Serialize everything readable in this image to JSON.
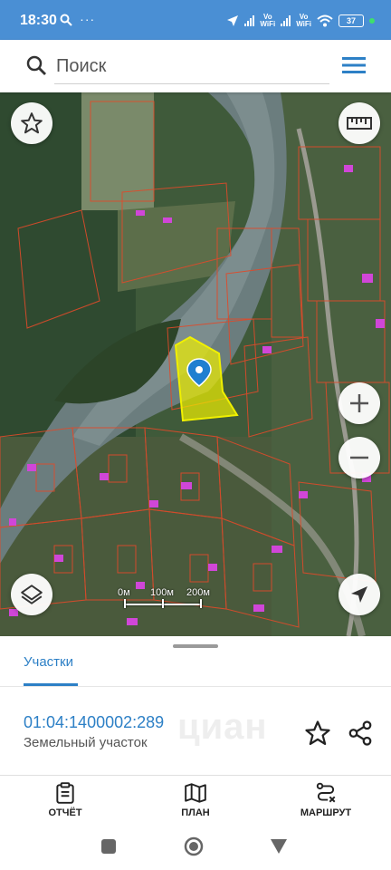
{
  "status_bar": {
    "time": "18:30",
    "left_icons": [
      "search-icon",
      "more-dots-icon"
    ],
    "vowifi_label": "Vo\nWiFi",
    "battery": "37",
    "colors": {
      "background": "#4a8fd4",
      "charge_dot": "#3ee06c"
    }
  },
  "search": {
    "placeholder": "Поиск",
    "value": ""
  },
  "map": {
    "scale_labels": [
      "0м",
      "100м",
      "200м"
    ],
    "buttons": [
      "favorite-star-icon",
      "ruler-icon",
      "zoom-in-icon",
      "zoom-out-icon",
      "layers-icon",
      "my-location-icon"
    ],
    "selected_parcel_color": "#f0f000"
  },
  "sheet": {
    "tab": "Участки",
    "parcel_id": "01:04:1400002:289",
    "parcel_type": "Земельный участок",
    "watermark": "циан",
    "accent_color": "#2d80c6"
  },
  "bottom_nav": {
    "items": [
      {
        "label": "ОТЧЁТ",
        "icon": "report-clipboard-icon"
      },
      {
        "label": "ПЛАН",
        "icon": "map-plan-icon"
      },
      {
        "label": "МАРШРУТ",
        "icon": "route-icon"
      }
    ]
  }
}
